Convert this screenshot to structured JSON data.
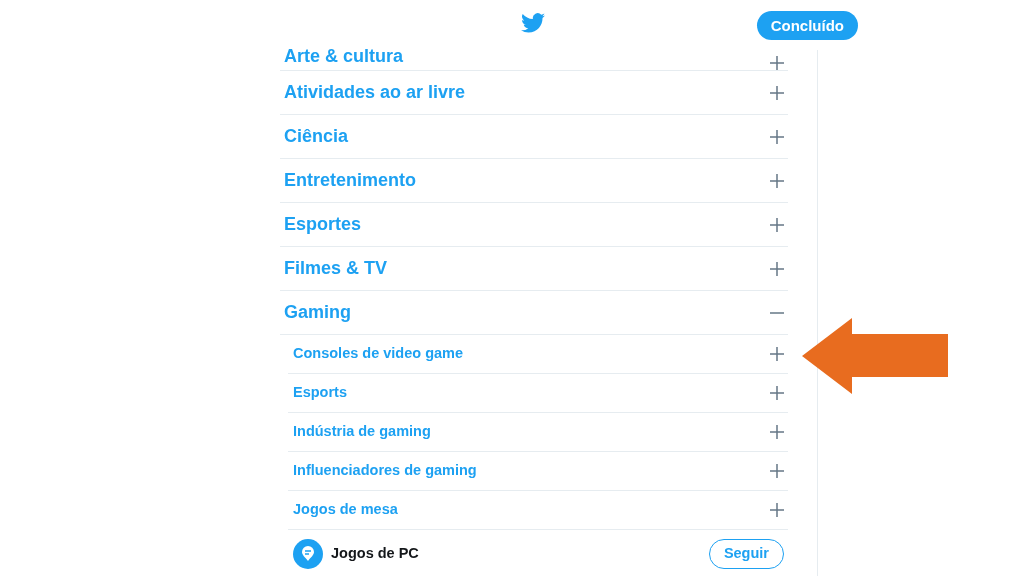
{
  "header": {
    "done_button": "Concluído"
  },
  "topics": [
    {
      "label": "Arte & cultura",
      "expanded": false
    },
    {
      "label": "Atividades ao ar livre",
      "expanded": false
    },
    {
      "label": "Ciência",
      "expanded": false
    },
    {
      "label": "Entretenimento",
      "expanded": false
    },
    {
      "label": "Esportes",
      "expanded": false
    },
    {
      "label": "Filmes & TV",
      "expanded": false
    },
    {
      "label": "Gaming",
      "expanded": true,
      "children": [
        {
          "kind": "subtopic",
          "label": "Consoles de video game"
        },
        {
          "kind": "subtopic",
          "label": "Esports"
        },
        {
          "kind": "subtopic",
          "label": "Indústria de gaming"
        },
        {
          "kind": "subtopic",
          "label": "Influenciadores de gaming"
        },
        {
          "kind": "subtopic",
          "label": "Jogos de mesa"
        },
        {
          "kind": "follow",
          "label": "Jogos de PC",
          "button": "Seguir"
        }
      ]
    }
  ]
}
